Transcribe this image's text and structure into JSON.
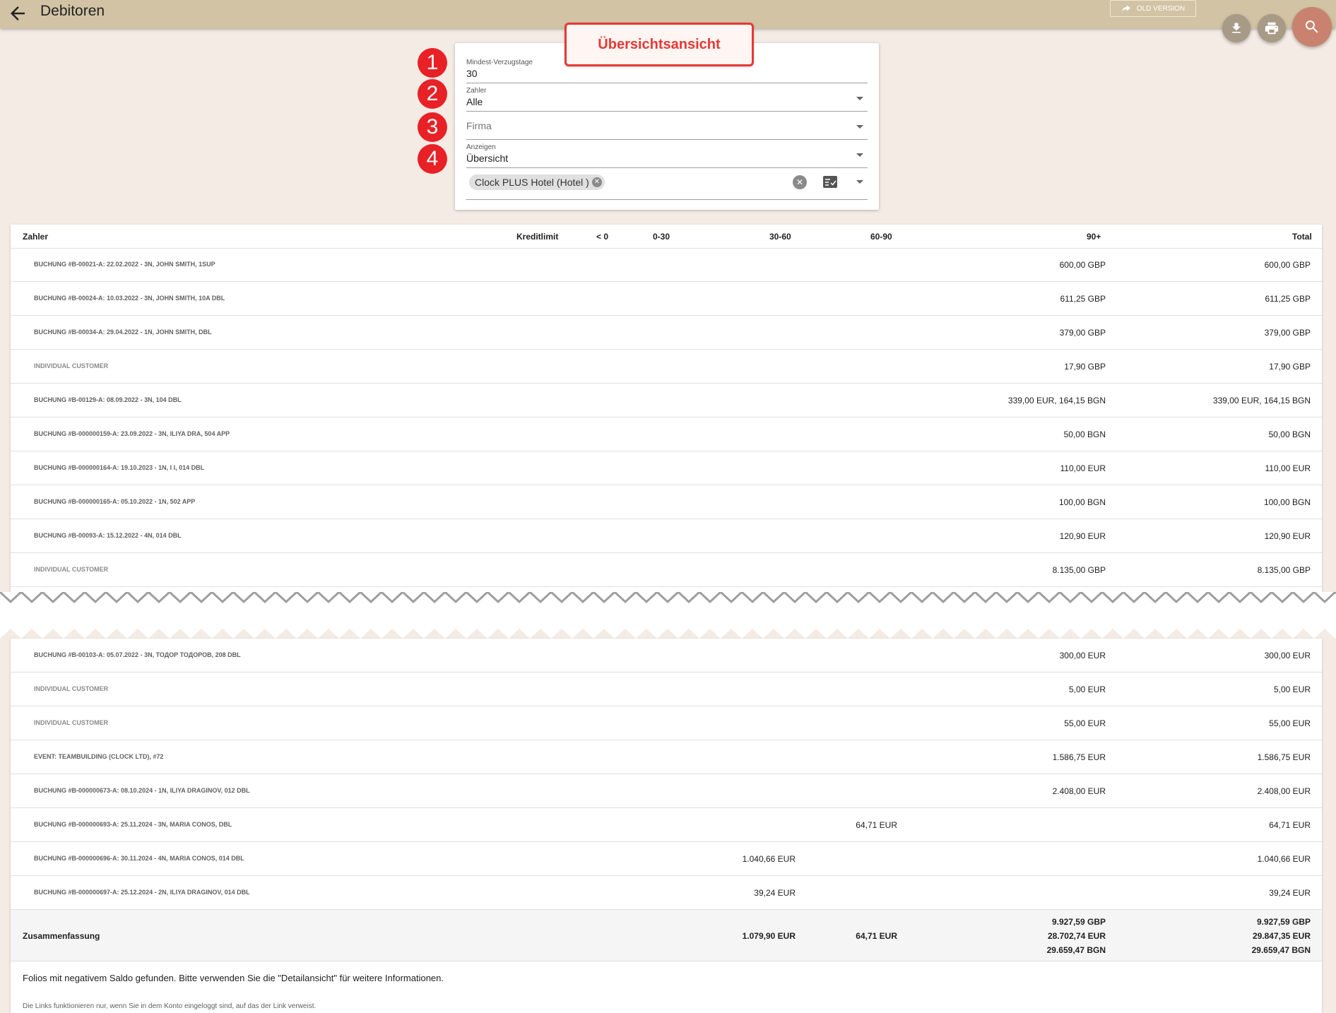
{
  "header": {
    "title": "Debitoren",
    "old_version_label": "OLD VERSION",
    "icons": [
      "arrow-left-icon",
      "share-arrow-icon",
      "download-icon",
      "print-icon",
      "search-icon"
    ]
  },
  "callout": "Übersichtsansicht",
  "badges": [
    "1",
    "2",
    "3",
    "4"
  ],
  "filters": {
    "min_days": {
      "label": "Mindest-Verzugstage",
      "value": "30"
    },
    "payer": {
      "label": "Zahler",
      "value": "Alle"
    },
    "company": {
      "placeholder": "Firma"
    },
    "display": {
      "label": "Anzeigen",
      "value": "Übersicht"
    },
    "property_chip": "Clock PLUS Hotel (Hotel )"
  },
  "table": {
    "columns": [
      "Zahler",
      "Kreditlimit",
      "< 0",
      "0-30",
      "30-60",
      "60-90",
      "90+",
      "Total"
    ],
    "rows_top": [
      {
        "payer": "BUCHUNG #B-00021-A: 22.02.2022 - 3N, JOHN SMITH, 1SUP",
        "d90": "600,00 GBP",
        "total": "600,00 GBP"
      },
      {
        "payer": "BUCHUNG #B-00024-A: 10.03.2022 - 3N, JOHN SMITH, 10A DBL",
        "d90": "611,25 GBP",
        "total": "611,25 GBP"
      },
      {
        "payer": "BUCHUNG #B-00034-A: 29.04.2022 - 1N, JOHN SMITH, DBL",
        "d90": "379,00 GBP",
        "total": "379,00 GBP"
      },
      {
        "payer": "INDIVIDUAL CUSTOMER",
        "d90": "17,90 GBP",
        "total": "17,90 GBP",
        "individual": true
      },
      {
        "payer": "BUCHUNG #B-00129-A: 08.09.2022 - 3N, 104 DBL",
        "d90": "339,00 EUR, 164,15 BGN",
        "total": "339,00 EUR, 164,15 BGN"
      },
      {
        "payer": "BUCHUNG #B-000000159-A: 23.09.2022 - 3N, ILIYA DRA, 504 APP",
        "d90": "50,00 BGN",
        "total": "50,00 BGN"
      },
      {
        "payer": "BUCHUNG #B-000000164-A: 19.10.2023 - 1N, I I, 014 DBL",
        "d90": "110,00 EUR",
        "total": "110,00 EUR"
      },
      {
        "payer": "BUCHUNG #B-000000165-A: 05.10.2022 - 1N, 502 APP",
        "d90": "100,00 BGN",
        "total": "100,00 BGN"
      },
      {
        "payer": "BUCHUNG #B-00093-A: 15.12.2022 - 4N, 014 DBL",
        "d90": "120,90 EUR",
        "total": "120,90 EUR"
      },
      {
        "payer": "INDIVIDUAL CUSTOMER",
        "d90": "8.135,00 GBP",
        "total": "8.135,00 GBP",
        "individual": true
      }
    ],
    "rows_bottom": [
      {
        "payer": "BUCHUNG #B-00103-A: 05.07.2022 - 3N, ТОДОР ТОДОРОВ, 208 DBL",
        "d90": "300,00 EUR",
        "total": "300,00 EUR"
      },
      {
        "payer": "INDIVIDUAL CUSTOMER",
        "d90": "5,00 EUR",
        "total": "5,00 EUR",
        "individual": true
      },
      {
        "payer": "INDIVIDUAL CUSTOMER",
        "d90": "55,00 EUR",
        "total": "55,00 EUR",
        "individual": true
      },
      {
        "payer": "EVENT: TEAMBUILDING (CLOCK LTD), #72",
        "d90": "1.586,75 EUR",
        "total": "1.586,75 EUR"
      },
      {
        "payer": "BUCHUNG #B-000000673-A: 08.10.2024 - 1N, ILIYA DRAGINOV, 012 DBL",
        "d90": "2.408,00 EUR",
        "total": "2.408,00 EUR"
      },
      {
        "payer": "BUCHUNG #B-000000693-A: 25.11.2024 - 3N, MARIA CONOS, DBL",
        "d60": "64,71 EUR",
        "total": "64,71 EUR"
      },
      {
        "payer": "BUCHUNG #B-000000696-A: 30.11.2024 - 4N, MARIA CONOS, 014 DBL",
        "d30": "1.040,66 EUR",
        "total": "1.040,66 EUR"
      },
      {
        "payer": "BUCHUNG #B-000000697-A: 25.12.2024 - 2N, ILIYA DRAGINOV, 014 DBL",
        "d30": "39,24 EUR",
        "total": "39,24 EUR"
      }
    ],
    "summary": {
      "label": "Zusammenfassung",
      "d30": "1.079,90 EUR",
      "d60": "64,71 EUR",
      "d90": [
        "9.927,59 GBP",
        "28.702,74 EUR",
        "29.659,47 BGN"
      ],
      "total": [
        "9.927,59 GBP",
        "29.847,35 EUR",
        "29.659,47 BGN"
      ]
    },
    "note": "Folios mit negativem Saldo gefunden. Bitte verwenden Sie die \"Detailansicht\" für weitere Informationen.",
    "footnote": "Die Links funktionieren nur, wenn Sie in dem Konto eingeloggt sind, auf das der Link verweist."
  }
}
